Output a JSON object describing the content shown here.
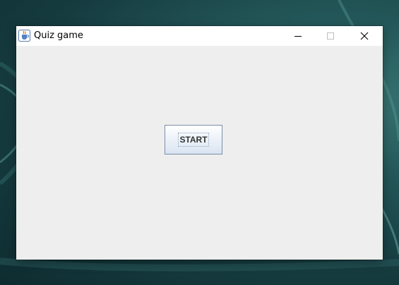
{
  "window": {
    "title": "Quiz game",
    "icon": "java-coffee-cup-icon",
    "controls": {
      "minimize_icon": "minimize-icon",
      "maximize_icon": "maximize-icon",
      "close_icon": "close-icon"
    }
  },
  "main": {
    "start_button_label": "START"
  },
  "colors": {
    "content_background": "#eeeeee",
    "titlebar_background": "#ffffff",
    "button_border": "#7a8ea7",
    "desktop_background": "#1c4a4c"
  }
}
